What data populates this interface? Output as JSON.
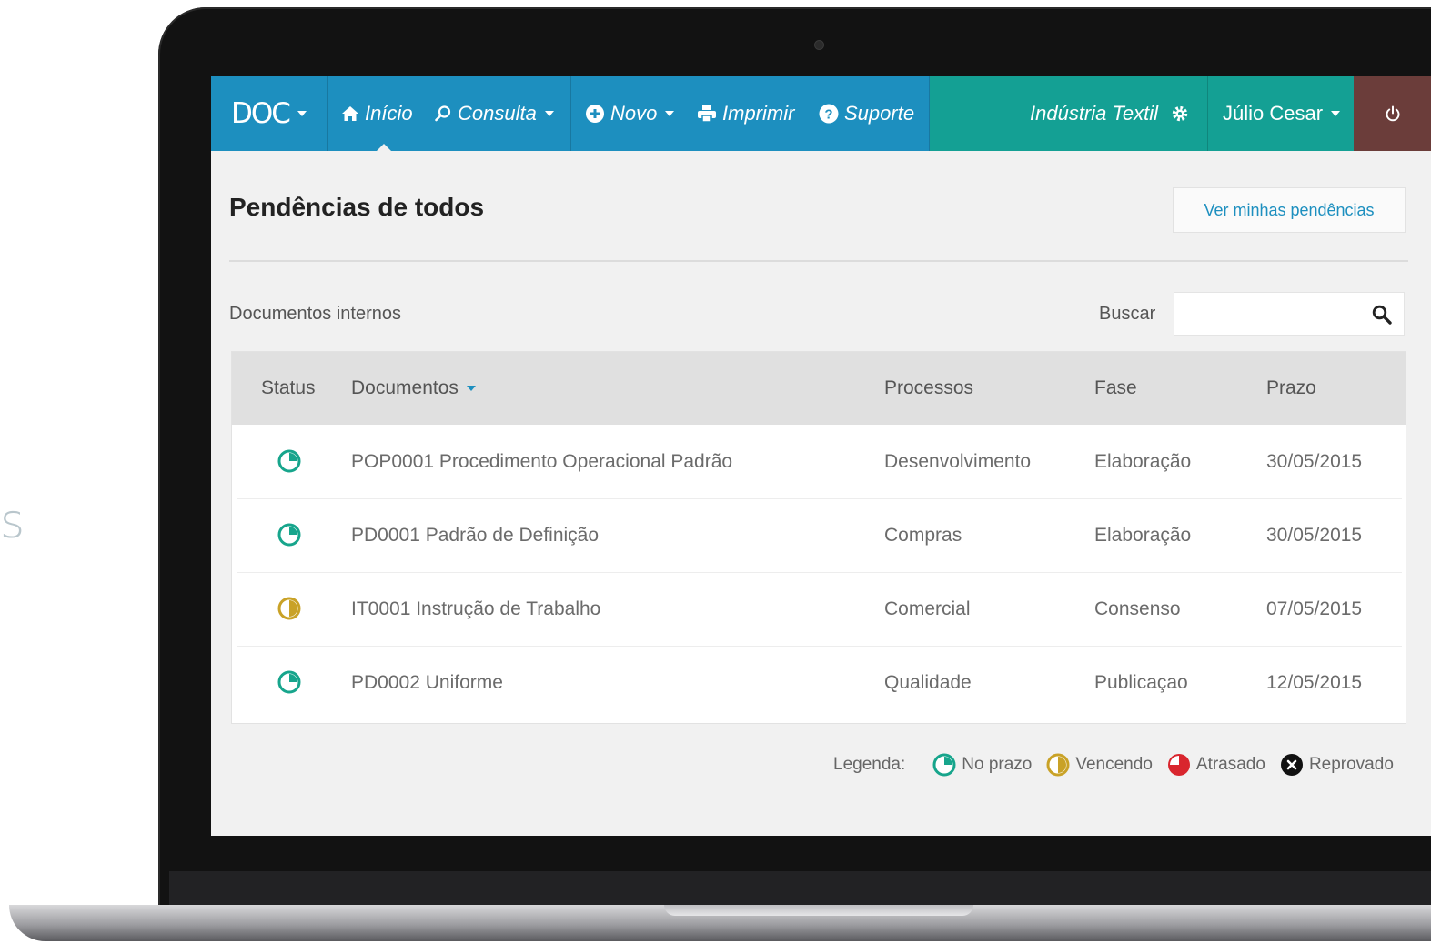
{
  "background": {
    "stray_letter": "s"
  },
  "navbar": {
    "brand": "DOC",
    "items": [
      {
        "label": "Início",
        "icon": "home-icon"
      },
      {
        "label": "Consulta",
        "icon": "search-icon"
      },
      {
        "label": "Novo",
        "icon": "plus-circle-icon"
      },
      {
        "label": "Imprimir",
        "icon": "printer-icon"
      },
      {
        "label": "Suporte",
        "icon": "question-circle-icon"
      }
    ],
    "company": "Indústria Textil",
    "user": "Júlio Cesar",
    "power_icon": "power-icon",
    "colors": {
      "blue": "#1d8fbf",
      "teal": "#14a094",
      "logout": "#6b3d3a"
    }
  },
  "page": {
    "title": "Pendências de todos",
    "mine_button": "Ver minhas pendências",
    "section": "Documentos internos",
    "search_label": "Buscar",
    "search_value": ""
  },
  "table": {
    "headers": [
      "Status",
      "Documentos",
      "Processos",
      "Fase",
      "Prazo"
    ],
    "rows": [
      {
        "status": "no-prazo",
        "documento": "POP0001 Procedimento Operacional Padrão",
        "processo": "Desenvolvimento",
        "fase": "Elaboração",
        "prazo": "30/05/2015"
      },
      {
        "status": "no-prazo",
        "documento": "PD0001 Padrão de Definição",
        "processo": "Compras",
        "fase": "Elaboração",
        "prazo": "30/05/2015"
      },
      {
        "status": "vencendo",
        "documento": "IT0001 Instrução de Trabalho",
        "processo": "Comercial",
        "fase": "Consenso",
        "prazo": "07/05/2015"
      },
      {
        "status": "no-prazo",
        "documento": "PD0002 Uniforme",
        "processo": "Qualidade",
        "fase": "Publicaçao",
        "prazo": "12/05/2015"
      }
    ]
  },
  "legend": {
    "label": "Legenda:",
    "items": [
      {
        "key": "no-prazo",
        "label": "No prazo",
        "color": "#17a58c"
      },
      {
        "key": "vencendo",
        "label": "Vencendo",
        "color": "#c9a227"
      },
      {
        "key": "atrasado",
        "label": "Atrasado",
        "color": "#d9262e"
      },
      {
        "key": "reprovado",
        "label": "Reprovado",
        "color": "#111111"
      }
    ]
  }
}
